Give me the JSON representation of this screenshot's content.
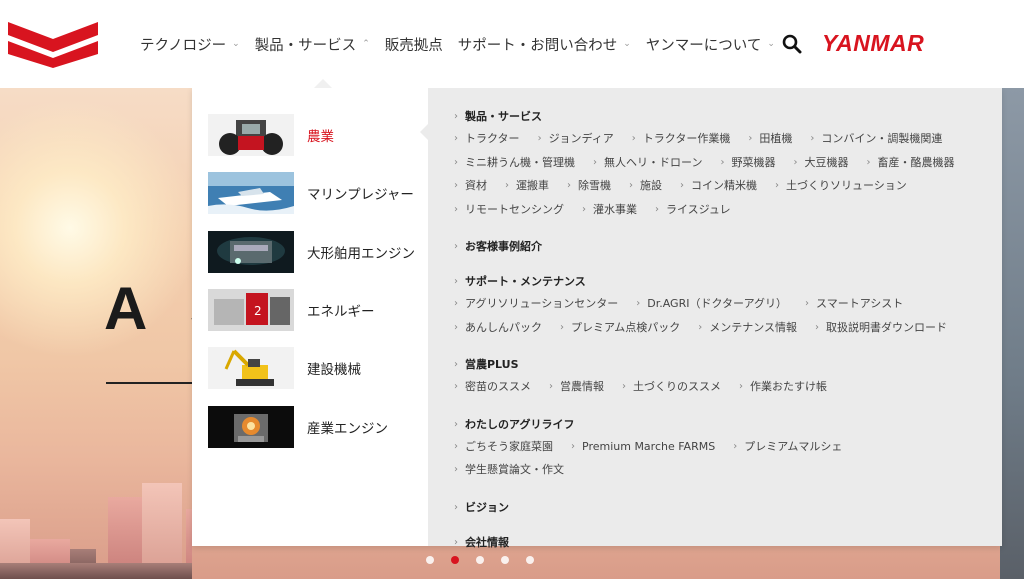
{
  "header": {
    "brand": "YANMAR",
    "nav": [
      {
        "label": "テクノロジー",
        "has_dropdown": true
      },
      {
        "label": "製品・サービス",
        "has_dropdown": true,
        "expanded": true
      },
      {
        "label": "販売拠点",
        "has_dropdown": false
      },
      {
        "label": "サポート・お問い合わせ",
        "has_dropdown": true
      },
      {
        "label": "ヤンマーについて",
        "has_dropdown": true
      }
    ]
  },
  "hero": {
    "title": "A S",
    "slide_count": 5,
    "active_slide": 2
  },
  "menu": {
    "categories": [
      {
        "label": "農業",
        "active": true
      },
      {
        "label": "マリンプレジャー"
      },
      {
        "label": "大形舶用エンジン"
      },
      {
        "label": "エネルギー"
      },
      {
        "label": "建設機械"
      },
      {
        "label": "産業エンジン"
      }
    ],
    "sections": [
      {
        "heading": "製品・サービス",
        "links": [
          "トラクター",
          "ジョンディア",
          "トラクター作業機",
          "田植機",
          "コンバイン・調製機関連",
          "ミニ耕うん機・管理機",
          "無人ヘリ・ドローン",
          "野菜機器",
          "大豆機器",
          "畜産・酪農機器",
          "資材",
          "運搬車",
          "除雪機",
          "施設",
          "コイン精米機",
          "土づくりソリューション",
          "リモートセンシング",
          "灌水事業",
          "ライスジュレ"
        ]
      },
      {
        "heading": "お客様事例紹介",
        "links": []
      },
      {
        "heading": "サポート・メンテナンス",
        "links": [
          "アグリソリューションセンター",
          "Dr.AGRI（ドクターアグリ）",
          "スマートアシスト",
          "あんしんパック",
          "プレミアム点検パック",
          "メンテナンス情報",
          "取扱説明書ダウンロード"
        ]
      },
      {
        "heading": "営農PLUS",
        "links": [
          "密苗のススメ",
          "営農情報",
          "土づくりのススメ",
          "作業おたすけ帳"
        ]
      },
      {
        "heading": "わたしのアグリライフ",
        "links": [
          "ごちそう家庭菜園",
          "Premium Marche FARMS",
          "プレミアムマルシェ",
          "学生懸賞論文・作文"
        ]
      },
      {
        "heading": "ビジョン",
        "links": []
      },
      {
        "heading": "会社情報",
        "links": []
      }
    ]
  },
  "colors": {
    "brand_red": "#d8141f",
    "menu_gray": "#ebebeb"
  },
  "icons": {
    "search": "search-icon",
    "logo": "yanmar-chevron-logo",
    "dropdown": "chevron-down-icon",
    "link_arrow": "chevron-right-icon"
  }
}
